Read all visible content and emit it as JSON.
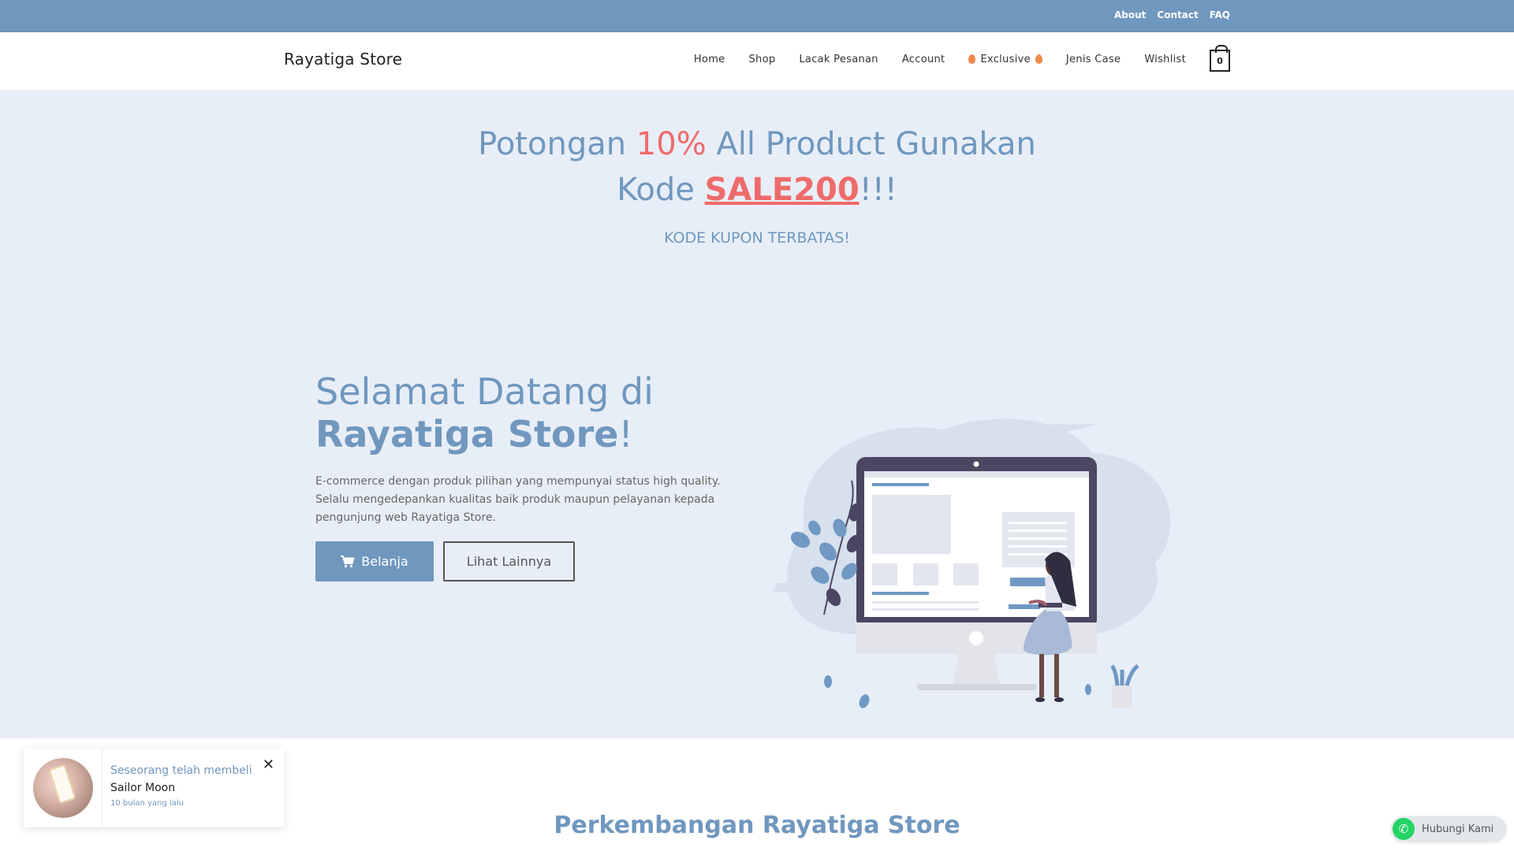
{
  "topbar": {
    "links": [
      "About",
      "Contact",
      "FAQ"
    ]
  },
  "header": {
    "logo": "Rayatiga Store",
    "nav": [
      "Home",
      "Shop",
      "Lacak Pesanan",
      "Account",
      "Exclusive",
      "Jenis Case",
      "Wishlist"
    ],
    "cart_count": "0"
  },
  "hero": {
    "promo_part1": "Potongan ",
    "promo_percent": "10%",
    "promo_part2": " All Product Gunakan",
    "promo_kode": "Kode ",
    "promo_code": "SALE200",
    "promo_bang": "!!!",
    "promo_sub": "KODE KUPON TERBATAS!",
    "welcome_line1": "Selamat Datang di",
    "welcome_brand": "Rayatiga Store",
    "welcome_excl": "!",
    "desc_line1": "E-commerce dengan produk pilihan yang mempunyai status high quality.",
    "desc_line2": "Selalu mengedepankan kualitas baik produk maupun pelayanan kepada",
    "desc_line3": "pengunjung web Rayatiga Store.",
    "btn_shop": "Belanja",
    "btn_more": "Lihat Lainnya"
  },
  "section": {
    "title": "Perkembangan Rayatiga Store"
  },
  "toast": {
    "title": "Seseorang telah membeli",
    "product": "Sailor Moon",
    "time": "10 bulan yang lalu"
  },
  "whatsapp": {
    "label": "Hubungi Kami"
  },
  "colors": {
    "brand": "#7097be",
    "accent": "#ef6b6b",
    "hero_bg": "#e8eef7"
  }
}
